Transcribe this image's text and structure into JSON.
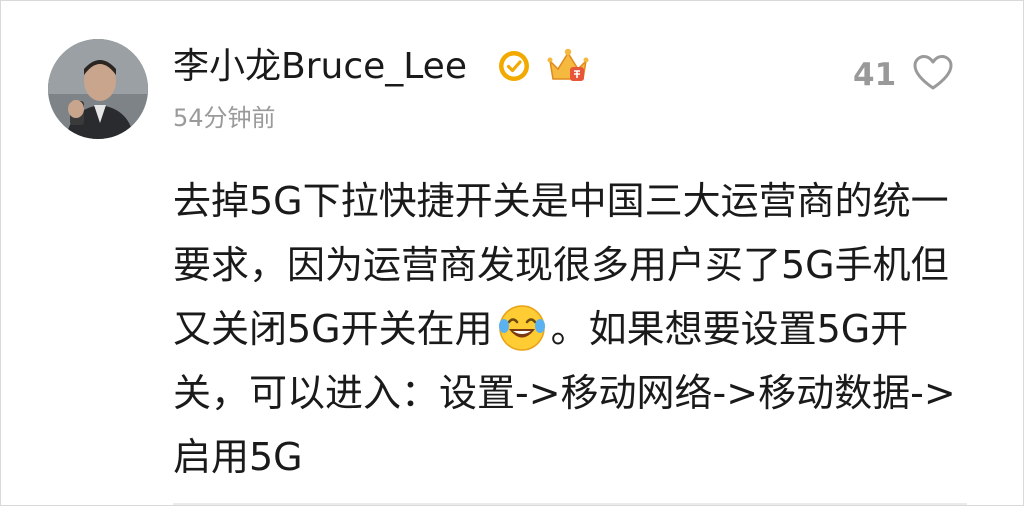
{
  "comment": {
    "user": {
      "name": "李小龙Bruce_Lee",
      "timestamp": "54分钟前"
    },
    "likes": {
      "count": "41"
    },
    "body": {
      "text_before_emoji": "去掉5G下拉快捷开关是中国三大运营商的统一要求，因为运营商发现很多用户买了5G手机但又关闭5G开关在用",
      "text_after_emoji": "。如果想要设置5G开关，可以进入：设置->移动网络->移动数据->启用5G"
    },
    "icons": {
      "verified": "verified-badge-icon",
      "crown": "crown-badge-icon",
      "heart": "heart-outline-icon",
      "emoji": "laughing-crying-emoji"
    },
    "colors": {
      "text": "#1a1a1a",
      "muted": "#9a9a9a",
      "verified_gold": "#f2a900",
      "emoji_yellow": "#ffcc33"
    }
  }
}
